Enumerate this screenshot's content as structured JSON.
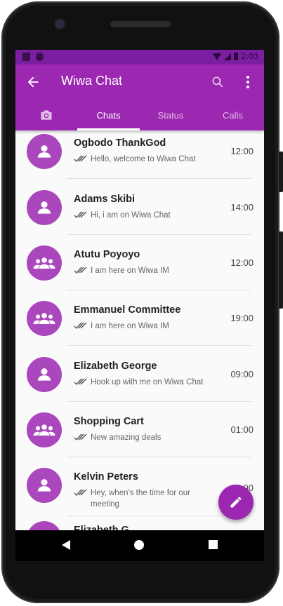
{
  "app": {
    "title": "Wiwa Chat",
    "accent": "#9c27b0",
    "statusbar_color": "#7b1fa2"
  },
  "statusbar": {
    "time": "2:03"
  },
  "tabs": [
    {
      "label": "",
      "icon": "camera-icon"
    },
    {
      "label": "Chats",
      "active": true
    },
    {
      "label": "Status"
    },
    {
      "label": "Calls"
    }
  ],
  "chats": [
    {
      "name": "Ogbodo ThankGod",
      "message": "Hello, welcome to Wiwa Chat",
      "time": "12:00",
      "avatar": "person-icon"
    },
    {
      "name": "Adams Skibi",
      "message": "Hi, i am on Wiwa Chat",
      "time": "14:00",
      "avatar": "person-icon"
    },
    {
      "name": "Atutu Poyoyo",
      "message": "I am here on Wiwa IM",
      "time": "12:00",
      "avatar": "group-icon"
    },
    {
      "name": "Emmanuel Committee",
      "message": "I am here on Wiwa IM",
      "time": "19:00",
      "avatar": "group-icon"
    },
    {
      "name": "Elizabeth George",
      "message": "Hook up with me on Wiwa Chat",
      "time": "09:00",
      "avatar": "person-icon"
    },
    {
      "name": "Shopping Cart",
      "message": "New amazing deals",
      "time": "01:00",
      "avatar": "group-icon"
    },
    {
      "name": "Kelvin Peters",
      "message": "Hey, when's the time for our meeting",
      "time": "10:00",
      "avatar": "person-icon"
    },
    {
      "name": "Elizabeth G",
      "message": "",
      "time": "",
      "avatar": "person-icon"
    }
  ],
  "fab": {
    "icon": "pencil-icon"
  }
}
